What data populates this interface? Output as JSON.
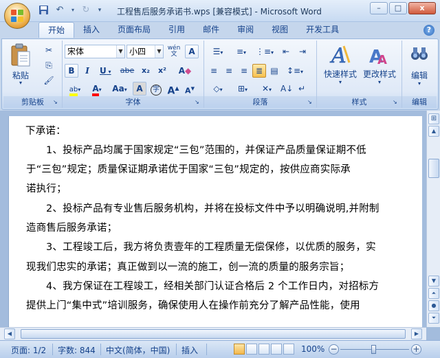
{
  "window": {
    "title": "工程售后服务承诺书.wps [兼容模式] - Microsoft Word",
    "minimize": "–",
    "maximize": "□",
    "close": "x"
  },
  "tabs": [
    "开始",
    "插入",
    "页面布局",
    "引用",
    "邮件",
    "审阅",
    "视图",
    "开发工具"
  ],
  "ribbon": {
    "clipboard": {
      "label": "剪贴板",
      "paste": "粘贴"
    },
    "font": {
      "label": "字体",
      "font_name": "宋体",
      "font_size": "小四",
      "bold": "B",
      "italic": "I",
      "underline": "U",
      "strike": "abe",
      "subscript": "x₂",
      "superscript": "x²",
      "change_case": "Aa",
      "grow": "A",
      "shrink": "A",
      "clear": "A",
      "phonetic": "wén",
      "char_border": "A",
      "char_shading": "A",
      "enclose": "字"
    },
    "paragraph": {
      "label": "段落"
    },
    "styles": {
      "label": "样式",
      "quick_styles": "快速样式",
      "change_styles": "更改样式"
    },
    "editing": {
      "label": "编辑",
      "edit": "编辑"
    }
  },
  "document": {
    "lines": [
      "下承诺：",
      "1、投标产品均属于国家规定“三包”范围的，并保证产品质量保证期不低",
      "于“三包”规定；质量保证期承诺优于国家“三包”规定的，按供应商实际承",
      "诺执行；",
      "2、投标产品有专业售后服务机构，并将在投标文件中予以明确说明,并附制",
      "造商售后服务承诺；",
      "3、工程竣工后，我方将负责壹年的工程质量无偿保修，以优质的服务，实",
      "现我们忠实的承诺；真正做到以一流的施工，创一流的质量的服务宗旨；",
      "4、我方保证在工程竣工，经相关部门认证合格后 2 个工作日内，对招标方",
      "提供上门“集中式”培训服务，确保使用人在操作前充分了解产品性能，使用"
    ]
  },
  "status": {
    "page": "页面: 1/2",
    "words": "字数: 844",
    "language": "中文(简体，中国)",
    "mode": "插入",
    "zoom": "100%"
  },
  "colors": {
    "highlight": "#ffff00",
    "font_color": "#ff0000"
  }
}
